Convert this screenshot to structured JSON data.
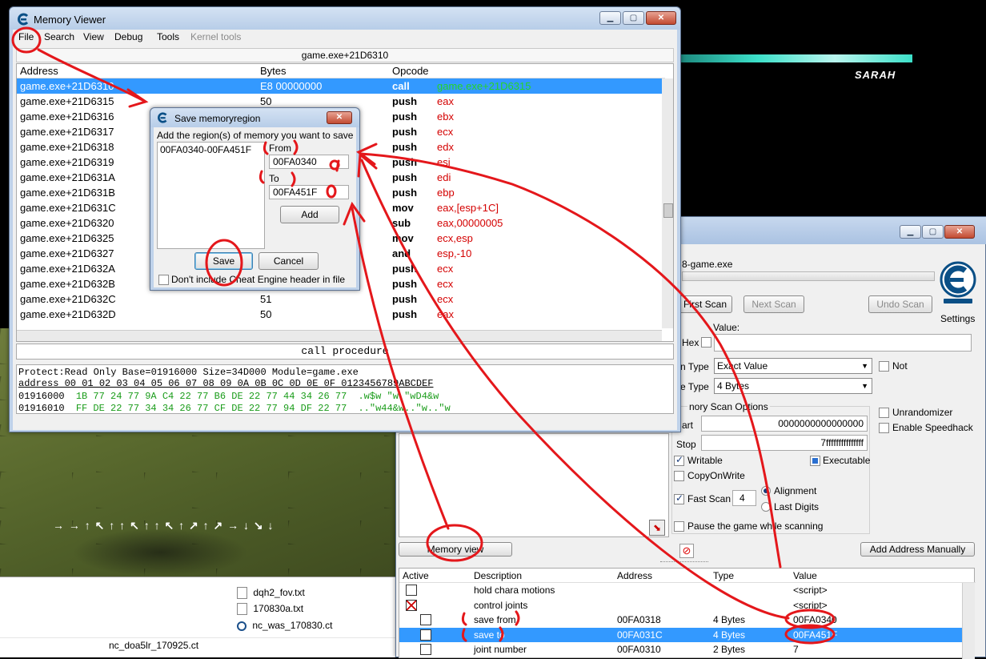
{
  "memory_viewer": {
    "title": "Memory Viewer",
    "menu": [
      "File",
      "Search",
      "View",
      "Debug",
      "Tools",
      "Kernel tools"
    ],
    "location": "game.exe+21D6310",
    "columns": {
      "address": "Address",
      "bytes": "Bytes",
      "opcode": "Opcode"
    },
    "rows": [
      {
        "address": "game.exe+21D6310",
        "bytes": "E8 00000000",
        "op": "call",
        "arg": "game.exe+21D6315"
      },
      {
        "address": "game.exe+21D6315",
        "bytes": "50",
        "op": "push",
        "arg": "eax"
      },
      {
        "address": "game.exe+21D6316",
        "bytes": "",
        "op": "push",
        "arg": "ebx"
      },
      {
        "address": "game.exe+21D6317",
        "bytes": "",
        "op": "push",
        "arg": "ecx"
      },
      {
        "address": "game.exe+21D6318",
        "bytes": "",
        "op": "push",
        "arg": "edx"
      },
      {
        "address": "game.exe+21D6319",
        "bytes": "",
        "op": "push",
        "arg": "esi"
      },
      {
        "address": "game.exe+21D631A",
        "bytes": "",
        "op": "push",
        "arg": "edi"
      },
      {
        "address": "game.exe+21D631B",
        "bytes": "",
        "op": "push",
        "arg": "ebp"
      },
      {
        "address": "game.exe+21D631C",
        "bytes": "",
        "op": "mov",
        "arg": "eax,[esp+1C]"
      },
      {
        "address": "game.exe+21D6320",
        "bytes": "",
        "op": "sub",
        "arg": "eax,00000005"
      },
      {
        "address": "game.exe+21D6325",
        "bytes": "",
        "op": "mov",
        "arg": "ecx,esp"
      },
      {
        "address": "game.exe+21D6327",
        "bytes": "",
        "op": "and",
        "arg": "esp,-10"
      },
      {
        "address": "game.exe+21D632A",
        "bytes": "",
        "op": "push",
        "arg": "ecx"
      },
      {
        "address": "game.exe+21D632B",
        "bytes": "",
        "op": "push",
        "arg": "ecx"
      },
      {
        "address": "game.exe+21D632C",
        "bytes": "51",
        "op": "push",
        "arg": "ecx"
      },
      {
        "address": "game.exe+21D632D",
        "bytes": "50",
        "op": "push",
        "arg": "eax"
      }
    ],
    "status": "call procedure",
    "hex_info": "Protect:Read Only  Base=01916000 Size=34D000 Module=game.exe",
    "hex_header": "address  00 01 02 03 04 05 06 07 08 09 0A 0B 0C 0D 0E 0F 0123456789ABCDEF",
    "hex_rows": [
      {
        "addr": "01916000",
        "bytes": "1B 77 24 77 9A C4 22 77 B6 DE 22 77 44 34 26 77",
        "ascii": ".w$w  \"w  \"wD4&w"
      },
      {
        "addr": "01916010",
        "bytes": "FF DE 22 77 34 34 26 77 CF DE 22 77 94 DF 22 77",
        "ascii": "..\"w44&w..\"w..\"w"
      }
    ]
  },
  "save_dialog": {
    "title": "Save memoryregion",
    "instruction": "Add the region(s) of memory you want to save",
    "list_item": "00FA0340-00FA451F",
    "from_label": "From",
    "from_value": "00FA0340",
    "to_label": "To",
    "to_value": "00FA451F",
    "add": "Add",
    "save": "Save",
    "cancel": "Cancel",
    "checkbox": "Don't include Cheat Engine header in file"
  },
  "game_hud": {
    "name": "SARAH",
    "arrows": "→ → ↑ ↖ ↑ ↑ ↖ ↑ ↑ ↖ ↑ ↗ ↑ ↗ → ↓ ↘ ↓"
  },
  "explorer": {
    "files": [
      "dqh2_fov.txt",
      "170830a.txt",
      "nc_was_170830.ct"
    ],
    "selected_file": "nc_doa5lr_170925.ct"
  },
  "cheat_engine": {
    "process": "8-game.exe",
    "first_scan": "First Scan",
    "next_scan": "Next Scan",
    "undo_scan": "Undo Scan",
    "settings": "Settings",
    "value_label": "Value:",
    "hex_label": "Hex",
    "scan_type_label": "n Type",
    "scan_type_value": "Exact Value",
    "value_type_label": "e Type",
    "value_type_value": "4 Bytes",
    "not_label": "Not",
    "mem_options": "nory Scan Options",
    "start_label": "art",
    "start_value": "0000000000000000",
    "stop_label": "Stop",
    "stop_value": "7fffffffffffffff",
    "writable": "Writable",
    "executable": "Executable",
    "copyonwrite": "CopyOnWrite",
    "fast_scan": "Fast Scan",
    "fast_scan_value": "4",
    "alignment": "Alignment",
    "last_digits": "Last Digits",
    "pause": "Pause the game while scanning",
    "unrandomizer": "Unrandomizer",
    "speedhack": "Enable Speedhack",
    "memory_view": "Memory view",
    "add_address": "Add Address Manually",
    "table_headers": [
      "Active",
      "Description",
      "Address",
      "Type",
      "Value"
    ],
    "table_rows": [
      {
        "desc": "hold chara motions",
        "addr": "",
        "type": "",
        "value": "<script>"
      },
      {
        "desc": "control joints",
        "addr": "",
        "type": "",
        "value": "<script>"
      },
      {
        "desc": "save from",
        "addr": "00FA0318",
        "type": "4 Bytes",
        "value": "00FA0340"
      },
      {
        "desc": "save to",
        "addr": "00FA031C",
        "type": "4 Bytes",
        "value": "00FA451F"
      },
      {
        "desc": "joint number",
        "addr": "00FA0310",
        "type": "2 Bytes",
        "value": "7"
      }
    ]
  },
  "colors": {
    "selection": "#3399ff",
    "annotation": "#e4171b",
    "opcode_red": "#d40000",
    "arg_blue": "#1f3cc9",
    "hex_green": "#1a9c1a"
  }
}
